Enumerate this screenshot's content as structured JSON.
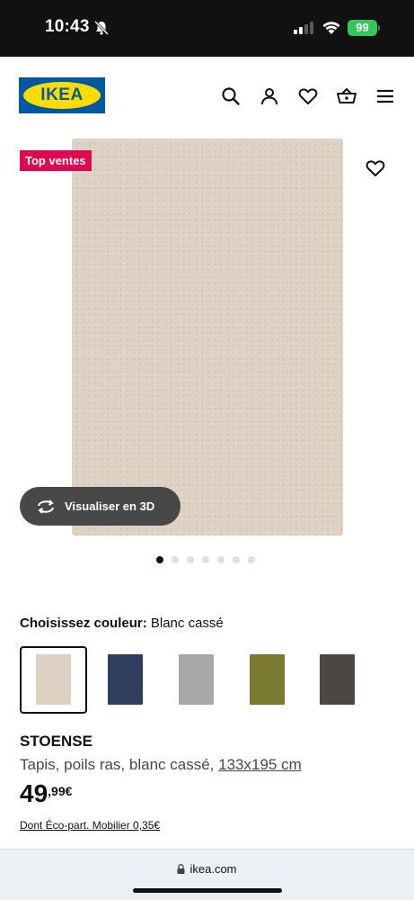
{
  "status_bar": {
    "time": "10:43",
    "battery": "99"
  },
  "header": {
    "logo_text": "IKEA"
  },
  "product_image": {
    "badge": "Top ventes",
    "view_3d_label": "Visualiser en 3D",
    "carousel_total": 7,
    "carousel_active": 1
  },
  "color_chooser": {
    "label": "Choisissez couleur:",
    "value": "Blanc cassé",
    "swatches": [
      {
        "color": "#ddd1c4",
        "selected": true
      },
      {
        "color": "#2f3e5c",
        "selected": false
      },
      {
        "color": "#a8a8a8",
        "selected": false
      },
      {
        "color": "#7a7a31",
        "selected": false
      },
      {
        "color": "#4c4644",
        "selected": false
      }
    ]
  },
  "product": {
    "name": "STOENSE",
    "description": "Tapis, poils ras, blanc cassé,",
    "size": "133x195 cm",
    "price_int": "49",
    "price_dec": ",99€",
    "eco_text": "Dont Éco-part. Mobilier 0,35€"
  },
  "browser": {
    "url": "ikea.com"
  },
  "colors": {
    "badge": "#e00751",
    "logo_blue": "#0058a3",
    "logo_yellow": "#ffdb00"
  }
}
